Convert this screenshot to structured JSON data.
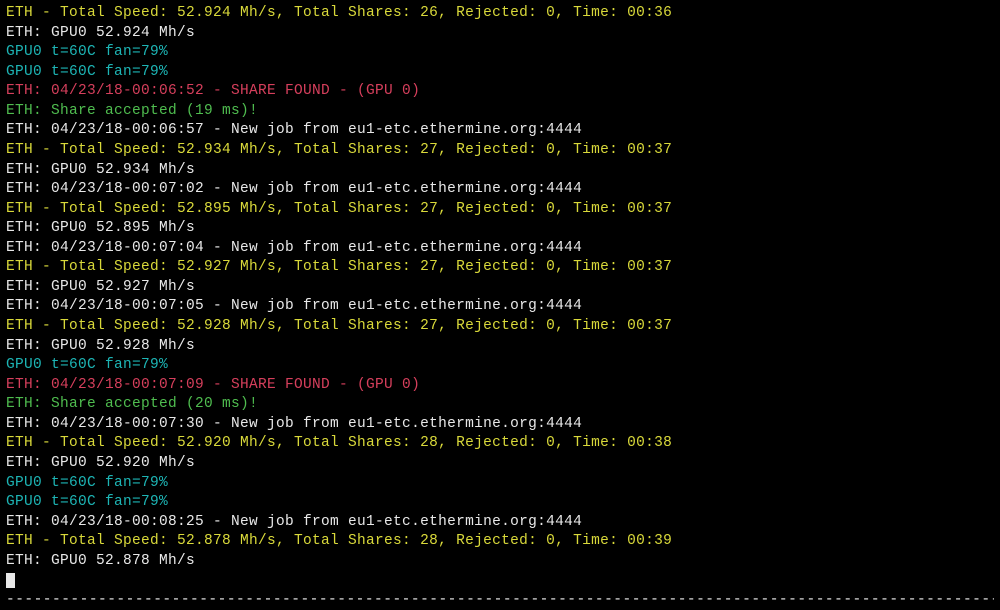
{
  "lines": [
    {
      "cls": "yellow",
      "text": "ETH - Total Speed: 52.924 Mh/s, Total Shares: 26, Rejected: 0, Time: 00:36"
    },
    {
      "cls": "white",
      "text": "ETH: GPU0 52.924 Mh/s"
    },
    {
      "cls": "cyan",
      "text": "GPU0 t=60C fan=79%"
    },
    {
      "cls": "cyan",
      "text": "GPU0 t=60C fan=79%"
    },
    {
      "cls": "red",
      "text": "ETH: 04/23/18-00:06:52 - SHARE FOUND - (GPU 0)"
    },
    {
      "cls": "green",
      "text": "ETH: Share accepted (19 ms)!"
    },
    {
      "cls": "white",
      "text": "ETH: 04/23/18-00:06:57 - New job from eu1-etc.ethermine.org:4444"
    },
    {
      "cls": "yellow",
      "text": "ETH - Total Speed: 52.934 Mh/s, Total Shares: 27, Rejected: 0, Time: 00:37"
    },
    {
      "cls": "white",
      "text": "ETH: GPU0 52.934 Mh/s"
    },
    {
      "cls": "white",
      "text": "ETH: 04/23/18-00:07:02 - New job from eu1-etc.ethermine.org:4444"
    },
    {
      "cls": "yellow",
      "text": "ETH - Total Speed: 52.895 Mh/s, Total Shares: 27, Rejected: 0, Time: 00:37"
    },
    {
      "cls": "white",
      "text": "ETH: GPU0 52.895 Mh/s"
    },
    {
      "cls": "white",
      "text": "ETH: 04/23/18-00:07:04 - New job from eu1-etc.ethermine.org:4444"
    },
    {
      "cls": "yellow",
      "text": "ETH - Total Speed: 52.927 Mh/s, Total Shares: 27, Rejected: 0, Time: 00:37"
    },
    {
      "cls": "white",
      "text": "ETH: GPU0 52.927 Mh/s"
    },
    {
      "cls": "white",
      "text": "ETH: 04/23/18-00:07:05 - New job from eu1-etc.ethermine.org:4444"
    },
    {
      "cls": "yellow",
      "text": "ETH - Total Speed: 52.928 Mh/s, Total Shares: 27, Rejected: 0, Time: 00:37"
    },
    {
      "cls": "white",
      "text": "ETH: GPU0 52.928 Mh/s"
    },
    {
      "cls": "cyan",
      "text": "GPU0 t=60C fan=79%"
    },
    {
      "cls": "red",
      "text": "ETH: 04/23/18-00:07:09 - SHARE FOUND - (GPU 0)"
    },
    {
      "cls": "green",
      "text": "ETH: Share accepted (20 ms)!"
    },
    {
      "cls": "white",
      "text": "ETH: 04/23/18-00:07:30 - New job from eu1-etc.ethermine.org:4444"
    },
    {
      "cls": "yellow",
      "text": "ETH - Total Speed: 52.920 Mh/s, Total Shares: 28, Rejected: 0, Time: 00:38"
    },
    {
      "cls": "white",
      "text": "ETH: GPU0 52.920 Mh/s"
    },
    {
      "cls": "cyan",
      "text": "GPU0 t=60C fan=79%"
    },
    {
      "cls": "cyan",
      "text": "GPU0 t=60C fan=79%"
    },
    {
      "cls": "white",
      "text": "ETH: 04/23/18-00:08:25 - New job from eu1-etc.ethermine.org:4444"
    },
    {
      "cls": "yellow",
      "text": "ETH - Total Speed: 52.878 Mh/s, Total Shares: 28, Rejected: 0, Time: 00:39"
    },
    {
      "cls": "white",
      "text": "ETH: GPU0 52.878 Mh/s"
    }
  ],
  "separator": "---------------------------------------------------------------------------------------------------------------"
}
